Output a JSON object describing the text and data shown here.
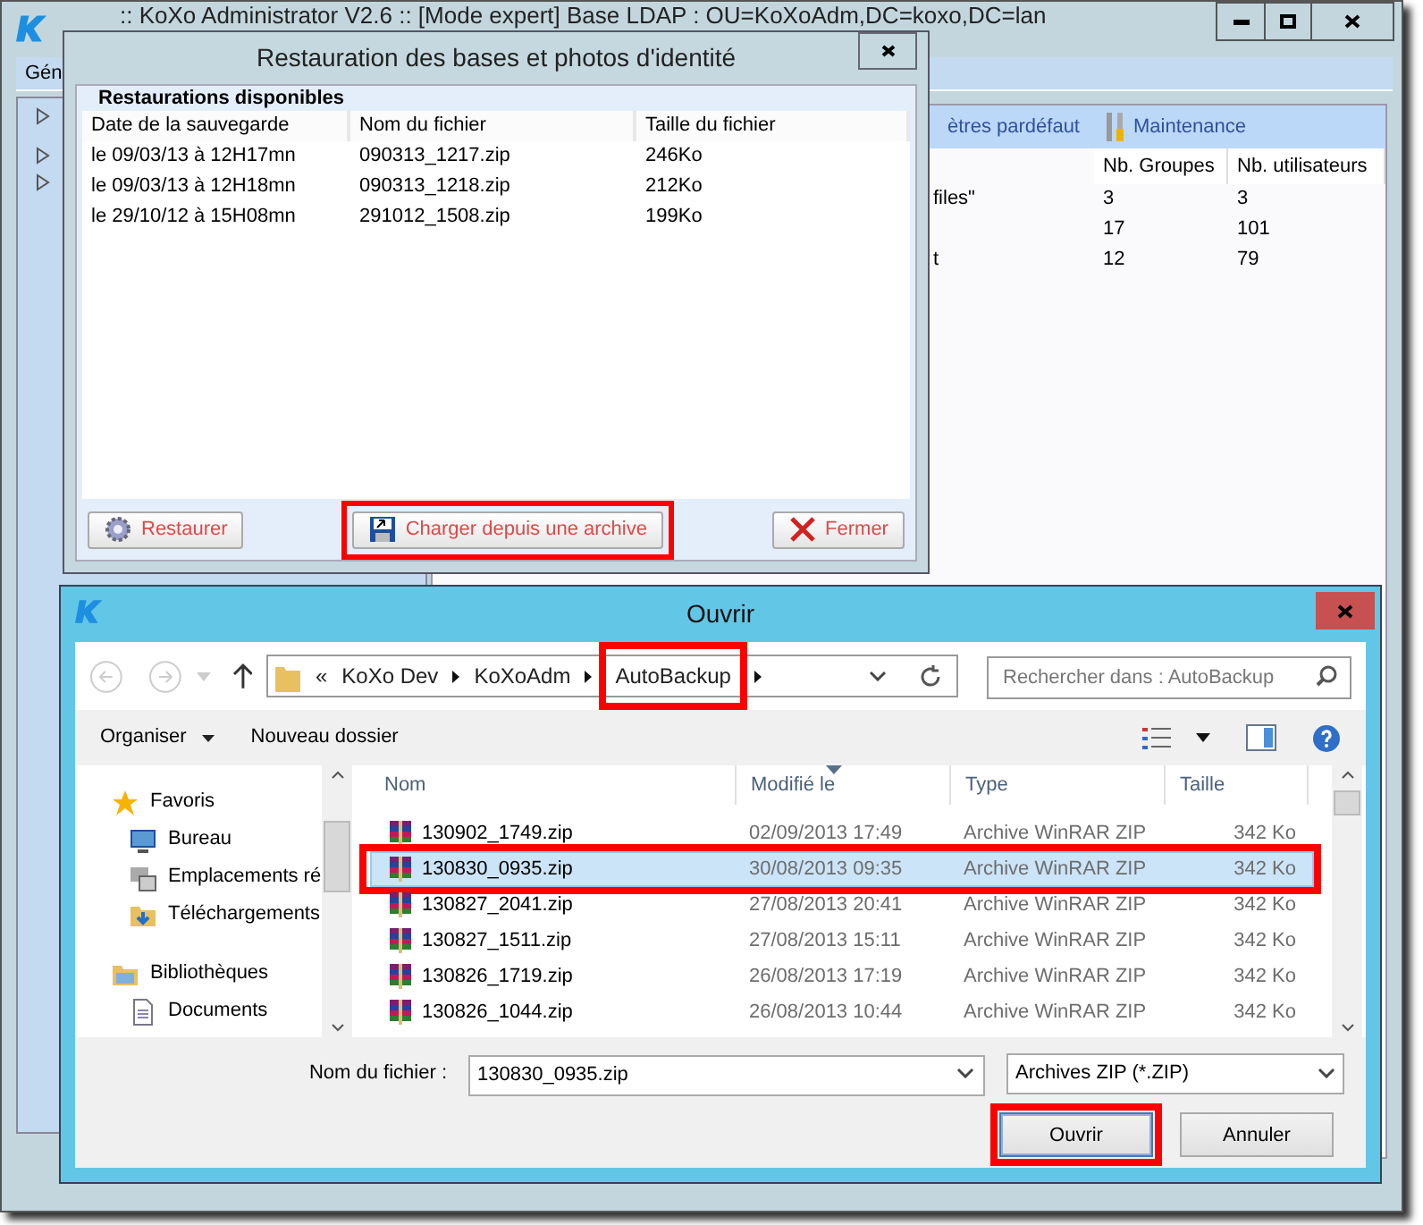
{
  "main_window": {
    "title": ":: KoXo Administrator V2.6 :: [Mode expert] Base LDAP : OU=KoXoAdm,DC=koxo,DC=lan",
    "menu": [
      {
        "label": "Gén"
      }
    ],
    "toolbar": [
      {
        "label": "ètres pardéfaut",
        "kind": "text"
      },
      {
        "label": "Maintenance",
        "kind": "tools"
      }
    ],
    "table": {
      "columns": [
        "Nb. Groupes",
        "Nb. utilisateurs"
      ],
      "rows": [
        {
          "name": "files\"",
          "groups": "3",
          "users": "3"
        },
        {
          "groups": "17",
          "users": "101"
        },
        {
          "name": "t",
          "groups": "12",
          "users": "79"
        }
      ]
    }
  },
  "restore_dialog": {
    "title": "Restauration des bases et photos d'identité",
    "group_title": "Restaurations disponibles",
    "columns": [
      "Date de la sauvegarde",
      "Nom du fichier",
      "Taille du fichier"
    ],
    "rows": [
      {
        "date": "le 09/03/13 à 12H17mn",
        "file": "090313_1217.zip",
        "size": "246Ko"
      },
      {
        "date": "le 09/03/13 à 12H18mn",
        "file": "090313_1218.zip",
        "size": "212Ko"
      },
      {
        "date": "le 29/10/12 à 15H08mn",
        "file": "291012_1508.zip",
        "size": "199Ko"
      }
    ],
    "buttons": [
      {
        "label": "Restaurer",
        "kind": "gear",
        "highlighted": false
      },
      {
        "label": "Charger depuis une archive",
        "kind": "disk",
        "highlighted": true
      },
      {
        "label": "Fermer",
        "kind": "cross",
        "highlighted": false
      }
    ]
  },
  "open_dialog": {
    "title": "Ouvrir",
    "breadcrumb": [
      {
        "label": "«",
        "highlighted": false
      },
      {
        "label": "KoXo Dev",
        "highlighted": false
      },
      {
        "label": "KoXoAdm",
        "highlighted": false
      },
      {
        "label": "AutoBackup",
        "highlighted": true
      }
    ],
    "search": {
      "placeholder": "Rechercher dans : AutoBackup"
    },
    "toolbar": [
      {
        "label": "Organiser",
        "kind": "menu"
      },
      {
        "label": "Nouveau dossier",
        "kind": "plain"
      }
    ],
    "nav": [
      {
        "label": "Favoris",
        "kind": "star",
        "children": [
          {
            "label": "Bureau",
            "kind": "desktop"
          },
          {
            "label": "Emplacements ré",
            "kind": "places"
          },
          {
            "label": "Téléchargements",
            "kind": "downloads"
          }
        ]
      },
      {
        "label": "Bibliothèques",
        "kind": "library",
        "children": [
          {
            "label": "Documents",
            "kind": "document"
          }
        ]
      }
    ],
    "columns": [
      {
        "label": "Nom",
        "sorted": false
      },
      {
        "label": "Modifié le",
        "sorted": true
      },
      {
        "label": "Type",
        "sorted": false
      },
      {
        "label": "Taille",
        "sorted": false
      }
    ],
    "files": [
      {
        "name": "130902_1749.zip",
        "modified": "02/09/2013 17:49",
        "type": "Archive WinRAR ZIP",
        "size": "342 Ko",
        "selected": false,
        "highlighted": false
      },
      {
        "name": "130830_0935.zip",
        "modified": "30/08/2013 09:35",
        "type": "Archive WinRAR ZIP",
        "size": "342 Ko",
        "selected": true,
        "highlighted": true
      },
      {
        "name": "130827_2041.zip",
        "modified": "27/08/2013 20:41",
        "type": "Archive WinRAR ZIP",
        "size": "342 Ko",
        "selected": false,
        "highlighted": false
      },
      {
        "name": "130827_1511.zip",
        "modified": "27/08/2013 15:11",
        "type": "Archive WinRAR ZIP",
        "size": "342 Ko",
        "selected": false,
        "highlighted": false
      },
      {
        "name": "130826_1719.zip",
        "modified": "26/08/2013 17:19",
        "type": "Archive WinRAR ZIP",
        "size": "342 Ko",
        "selected": false,
        "highlighted": false
      },
      {
        "name": "130826_1044.zip",
        "modified": "26/08/2013 10:44",
        "type": "Archive WinRAR ZIP",
        "size": "342 Ko",
        "selected": false,
        "highlighted": false
      }
    ],
    "filename": {
      "label": "Nom du fichier :",
      "value": "130830_0935.zip"
    },
    "filter": {
      "value": "Archives ZIP (*.ZIP)"
    },
    "buttons": [
      {
        "label": "Ouvrir",
        "default": true,
        "highlighted": true
      },
      {
        "label": "Annuler",
        "default": false,
        "highlighted": false
      }
    ]
  }
}
